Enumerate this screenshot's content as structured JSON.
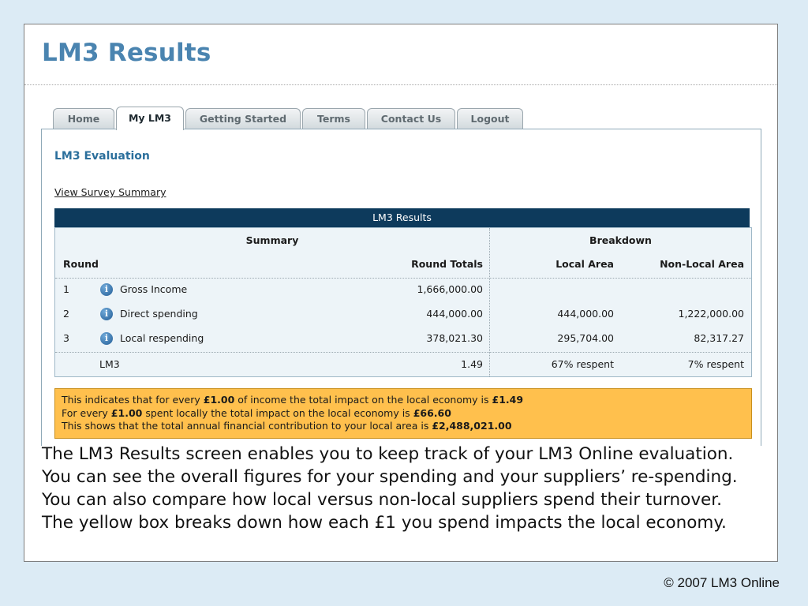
{
  "slide": {
    "title": "LM3 Results",
    "caption": "The LM3 Results screen enables you to keep track of your LM3 Online evaluation. You can see the overall figures for your spending and your suppliers’ re-spending. You can also compare how local versus non-local suppliers spend their turnover. The yellow box breaks down how each £1 you spend impacts the local economy.",
    "footer": "© 2007 LM3 Online"
  },
  "nav": {
    "tabs": [
      "Home",
      "My LM3",
      "Getting Started",
      "Terms",
      "Contact Us",
      "Logout"
    ],
    "active": "My LM3"
  },
  "page": {
    "heading": "LM3 Evaluation",
    "survey_link": "View Survey Summary"
  },
  "results": {
    "header": "LM3 Results",
    "summary_label": "Summary",
    "breakdown_label": "Breakdown",
    "columns": {
      "round": "Round",
      "round_totals": "Round Totals",
      "local_area": "Local Area",
      "non_local_area": "Non-Local Area"
    },
    "rows": [
      {
        "round": "1",
        "name": "Gross Income",
        "total": "1,666,000.00",
        "local": "",
        "non_local": ""
      },
      {
        "round": "2",
        "name": "Direct spending",
        "total": "444,000.00",
        "local": "444,000.00",
        "non_local": "1,222,000.00"
      },
      {
        "round": "3",
        "name": "Local respending",
        "total": "378,021.30",
        "local": "295,704.00",
        "non_local": "82,317.27"
      }
    ],
    "lm3_row": {
      "name": "LM3",
      "total": "1.49",
      "local": "67% respent",
      "non_local": "7% respent"
    }
  },
  "summary_box": {
    "line1": {
      "a": "This indicates that for every ",
      "b": "£1.00",
      "c": " of income the total impact on the local economy is ",
      "d": "£1.49"
    },
    "line2": {
      "a": "For every ",
      "b": "£1.00",
      "c": " spent locally the total impact on the local economy is ",
      "d": "£66.60"
    },
    "line3": {
      "a": "This shows that the total annual financial contribution to your local area is ",
      "b": "£2,488,021.00"
    }
  },
  "colors": {
    "background": "#dcebf5",
    "title": "#4a84b0",
    "results_header": "#0d3a5c",
    "results_box": "#edf4f8",
    "highlight_box": "#ffc04d"
  },
  "icons": [
    "info-icon"
  ]
}
